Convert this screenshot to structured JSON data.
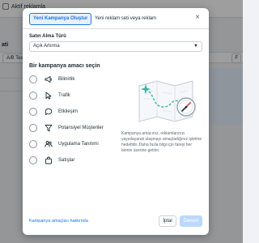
{
  "background": {
    "top_link_label": "Aktif reklamla",
    "page_title": "ati",
    "filter_button": "A/B Testi",
    "right_button": "F"
  },
  "modal": {
    "tabs": [
      {
        "label": "Yeni Kampanya Oluştur",
        "active": true
      },
      {
        "label": "Yeni reklam seti veya reklam",
        "active": false
      }
    ],
    "close_label": "×",
    "buying_type_label": "Satın Alma Türü",
    "buying_type_value": "Açık Artırma",
    "goal_heading": "Bir kampanya amacı seçin",
    "objectives": [
      {
        "label": "Bilinirlik",
        "icon": "megaphone-icon"
      },
      {
        "label": "Trafik",
        "icon": "cursor-icon"
      },
      {
        "label": "Etkileşim",
        "icon": "chat-bubble-icon"
      },
      {
        "label": "Potansiyel Müşteriler",
        "icon": "funnel-icon"
      },
      {
        "label": "Uygulama Tanıtımı",
        "icon": "people-icon"
      },
      {
        "label": "Satışlar",
        "icon": "shopping-bag-icon"
      }
    ],
    "description": "Kampanya amacınız, reklamlarınızı yayınlayarak ulaşmayı amaçladığınız işletme hedefidir. Daha fazla bilgi için fareyi her birinin üzerine getirin.",
    "footer_link": "Kampanya amaçları hakkında",
    "cancel_label": "İptal",
    "continue_label": "Devam"
  },
  "colors": {
    "accent": "#1b74e4",
    "accent_light": "#e7f0fd",
    "continue_disabled": "#bcd8fb",
    "illustration_teal": "#3ab5a0"
  }
}
